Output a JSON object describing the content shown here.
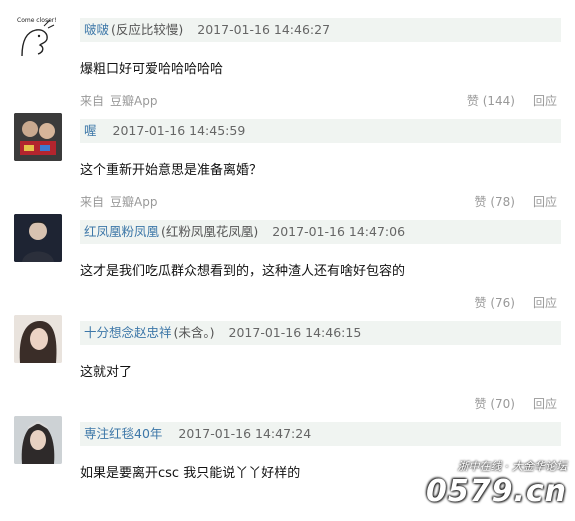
{
  "comments": [
    {
      "username": "啵啵",
      "note": "(反应比较慢)",
      "time": "2017-01-16 14:46:27",
      "content": "爆粗口好可爱哈哈哈哈哈",
      "source_prefix": "来自",
      "source_app": "豆瓣App",
      "like": "赞 (144)",
      "reply": "回应",
      "avatar_icon": "sketch-avatar"
    },
    {
      "username": "喔",
      "note": "",
      "time": "2017-01-16 14:45:59",
      "content": "这个重新开始意思是准备离婚？",
      "source_prefix": "来自",
      "source_app": "豆瓣App",
      "like": "赞 (78)",
      "reply": "回应",
      "avatar_icon": "photo-avatar"
    },
    {
      "username": "红凤凰粉凤凰",
      "note": "(红粉凤凰花凤凰)",
      "time": "2017-01-16 14:47:06",
      "content": "这才是我们吃瓜群众想看到的，这种渣人还有啥好包容的",
      "source_prefix": "",
      "source_app": "",
      "like": "赞 (76)",
      "reply": "回应",
      "avatar_icon": "photo-avatar"
    },
    {
      "username": "十分想念赵忠祥",
      "note": "(未含。)",
      "time": "2017-01-16 14:46:15",
      "content": "这就对了",
      "source_prefix": "",
      "source_app": "",
      "like": "赞 (70)",
      "reply": "回应",
      "avatar_icon": "photo-avatar"
    },
    {
      "username": "専注红毯40年",
      "note": "",
      "time": "2017-01-16 14:47:24",
      "content": "如果是要离开csc 我只能说丫丫好样的",
      "source_prefix": "",
      "source_app": "",
      "like": "",
      "reply": "",
      "avatar_icon": "photo-avatar"
    }
  ],
  "watermark": {
    "small": "浙中在线 · 大金华论坛",
    "big": "0579.cn"
  },
  "avatar_text": "Come closer!"
}
